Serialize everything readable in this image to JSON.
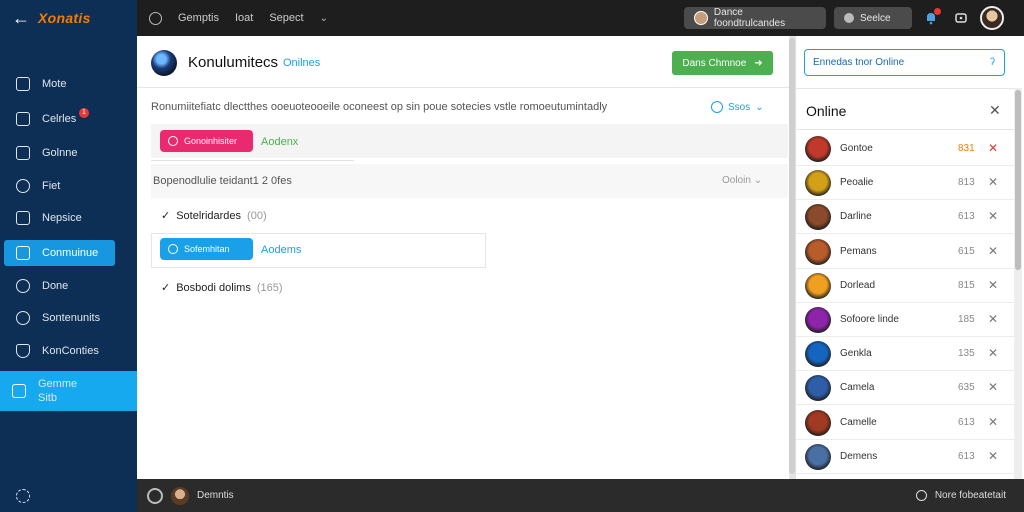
{
  "app": {
    "logo": "Xonatis",
    "back_glyph": "←"
  },
  "topnav": {
    "items": [
      "Gemptis",
      "Ioat",
      "Sepect"
    ],
    "chevron": "⌄"
  },
  "topright": {
    "account_pill": "Dance foondtrulcandes",
    "search_pill": "Seelce",
    "notification_icon": "bell-icon",
    "window_icon": "window-icon"
  },
  "sidebar": {
    "items": [
      {
        "label": "Mote",
        "icon": "home-icon",
        "active": false
      },
      {
        "label": "Celrles",
        "icon": "bag-icon",
        "active": false,
        "badge": "1"
      },
      {
        "label": "Golnne",
        "icon": "calendar-icon",
        "active": false
      },
      {
        "label": "Fiet",
        "icon": "disc-icon",
        "active": false
      },
      {
        "label": "Nepsice",
        "icon": "chart-icon",
        "active": false
      },
      {
        "label": "Conmuinue",
        "icon": "folder-icon",
        "active": true
      },
      {
        "label": "Done",
        "icon": "clock-icon",
        "active": false
      },
      {
        "label": "Sontenunits",
        "icon": "pin-icon",
        "active": false
      },
      {
        "label": "KonConties",
        "icon": "shield-icon",
        "active": false
      }
    ],
    "big_item": {
      "label_line1": "Gemme",
      "label_line2": "Sitb",
      "icon": "fork-icon"
    }
  },
  "main": {
    "title": "Konulumitecs",
    "status": "Onilnes",
    "action_button": "Dans Chmnoe",
    "description": "Ronumiitefiatc dlectthes ooeuoteooeile oconeest op sin  poue sotecies vstle romoeutumintadly",
    "sort_label": "Ssos",
    "tag1": {
      "label": "Gonoinhisiter",
      "text": "Aodenx"
    },
    "section": {
      "label": "Bopenodlulie teidant1 2 0fes",
      "right": "Ooloin"
    },
    "group1": {
      "label": "Sotelridardes",
      "count": "(00)"
    },
    "tag2": {
      "label": "Sofemhitan",
      "text": "Aodems"
    },
    "group2": {
      "label": "Bosbodi dolims",
      "count": "(165)"
    }
  },
  "rpanel": {
    "online_button": "Ennedas tnor Online",
    "title": "Online",
    "members": [
      {
        "name": "Gontoe",
        "count": "831",
        "color": "#c0392b"
      },
      {
        "name": "Peoalie",
        "count": "813",
        "color": "#d4a017"
      },
      {
        "name": "Darline",
        "count": "613",
        "color": "#8b4a2b"
      },
      {
        "name": "Pemans",
        "count": "615",
        "color": "#b85c2c"
      },
      {
        "name": "Dorlead",
        "count": "815",
        "color": "#f0a020"
      },
      {
        "name": "Sofoore linde",
        "count": "185",
        "color": "#8e24aa"
      },
      {
        "name": "Genkla",
        "count": "135",
        "color": "#1565c0"
      },
      {
        "name": "Camela",
        "count": "635",
        "color": "#2f5ea8"
      },
      {
        "name": "Camelle",
        "count": "613",
        "color": "#a03a22"
      },
      {
        "name": "Demens",
        "count": "613",
        "color": "#4a6fa5"
      }
    ]
  },
  "bottombar": {
    "user": "Demntis",
    "right_label": "Nore fobeatetait"
  }
}
